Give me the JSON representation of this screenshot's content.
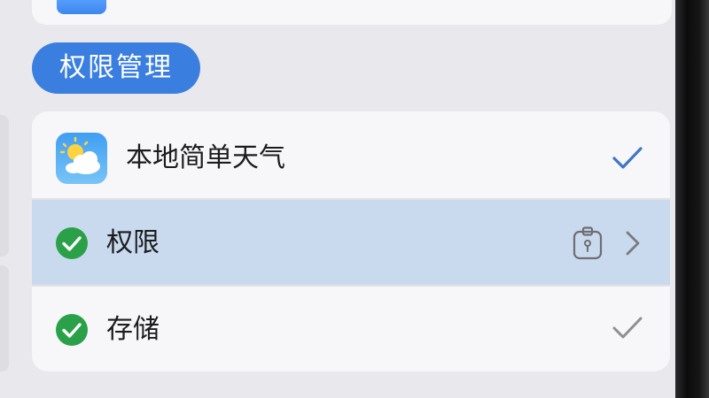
{
  "section": {
    "title": "权限管理"
  },
  "app_row": {
    "app_name": "本地简单天气",
    "icon": "weather-app-icon",
    "status_icon": "checkmark-icon"
  },
  "items": [
    {
      "label": "权限",
      "status_icon": "green-check-circle-icon",
      "trailing_icons": [
        "lock-badge-icon",
        "chevron-right-icon"
      ],
      "highlighted": true
    },
    {
      "label": "存储",
      "status_icon": "green-check-circle-icon",
      "trailing_icons": [
        "checkmark-icon"
      ],
      "highlighted": false
    }
  ],
  "colors": {
    "accent_blue": "#3a7fe0",
    "highlight_row": "#c9daee",
    "check_green": "#2aa148",
    "checkmark_blue": "#3f76c6",
    "checkmark_gray": "#8e8e93"
  }
}
